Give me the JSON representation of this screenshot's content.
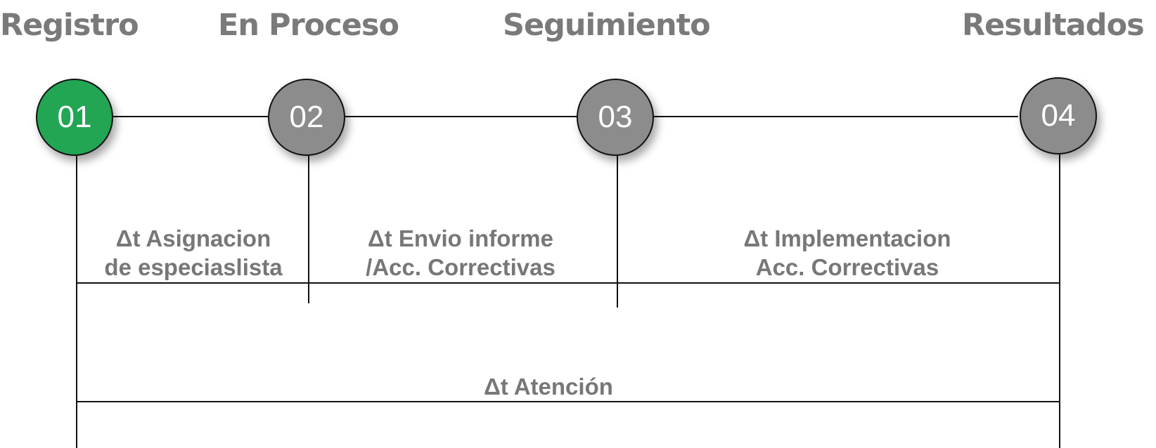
{
  "stages": [
    {
      "title": "Registro",
      "number": "01"
    },
    {
      "title": "En Proceso",
      "number": "02"
    },
    {
      "title": "Seguimiento",
      "number": "03"
    },
    {
      "title": "Resultados",
      "number": "04"
    }
  ],
  "intervals": [
    {
      "line1": "Δt Asignacion",
      "line2": "de especiaslista"
    },
    {
      "line1": "Δt Envio informe",
      "line2": "/Acc. Correctivas"
    },
    {
      "line1": "Δt Implementacion",
      "line2": "Acc. Correctivas"
    }
  ],
  "total_interval": {
    "label": "Δt Atención"
  },
  "colors": {
    "active_step": "#22a653",
    "inactive_step": "#8c8c8c",
    "title_text": "#7a7a7a",
    "label_text": "#777777",
    "lines": "#111111"
  }
}
